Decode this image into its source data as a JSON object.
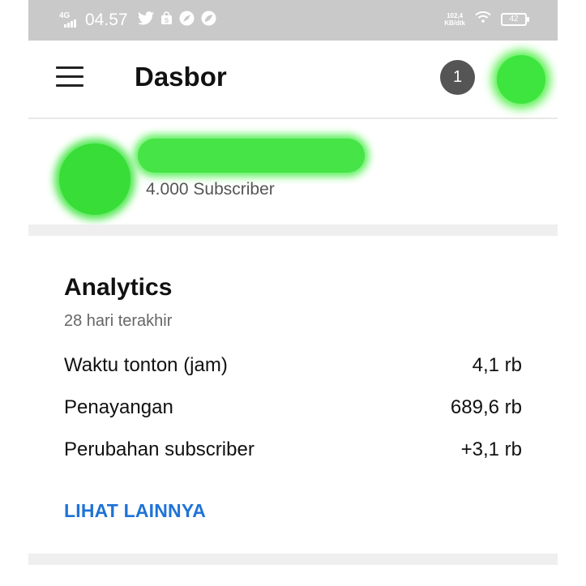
{
  "status_bar": {
    "network": "4G",
    "time": "04.57",
    "speed_value": "102,4",
    "speed_unit": "KB/dtk",
    "battery": "42",
    "icons": [
      "twitter-icon",
      "shopping-bag-icon",
      "compass-icon",
      "leaf-icon",
      "wifi-icon"
    ]
  },
  "app_bar": {
    "title": "Dasbor",
    "notification_count": "1"
  },
  "channel": {
    "subscribers": "4.000 Subscriber"
  },
  "analytics": {
    "title": "Analytics",
    "period": "28 hari terakhir",
    "metrics": [
      {
        "label": "Waktu tonton (jam)",
        "value": "4,1 rb"
      },
      {
        "label": "Penayangan",
        "value": "689,6 rb"
      },
      {
        "label": "Perubahan subscriber",
        "value": "+3,1 rb"
      }
    ],
    "more_link": "LIHAT LAINNYA"
  },
  "colors": {
    "accent": "#1f73d6",
    "redaction": "#46e446",
    "status_bar": "#c9c9c9"
  }
}
